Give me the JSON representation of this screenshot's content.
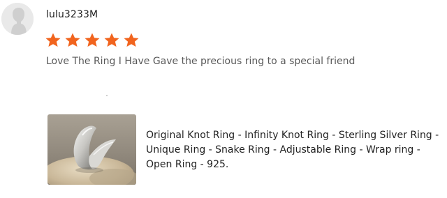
{
  "review": {
    "username": "lulu3233M",
    "rating": 5,
    "rating_max": 5,
    "text": "Love The Ring I Have Gave the precious ring to a special friend"
  },
  "product": {
    "title": "Original Knot Ring - Infinity Knot Ring - Sterling Silver Ring - Unique Ring - Snake Ring - Adjustable Ring - Wrap ring - Open Ring - 925."
  },
  "colors": {
    "star": "#f1641e",
    "avatar_bg": "#e9e9e9",
    "avatar_fg": "#cfcfcf",
    "review_text": "#595959"
  },
  "icons": {
    "avatar": "user-silhouette-icon",
    "star": "star-icon"
  }
}
